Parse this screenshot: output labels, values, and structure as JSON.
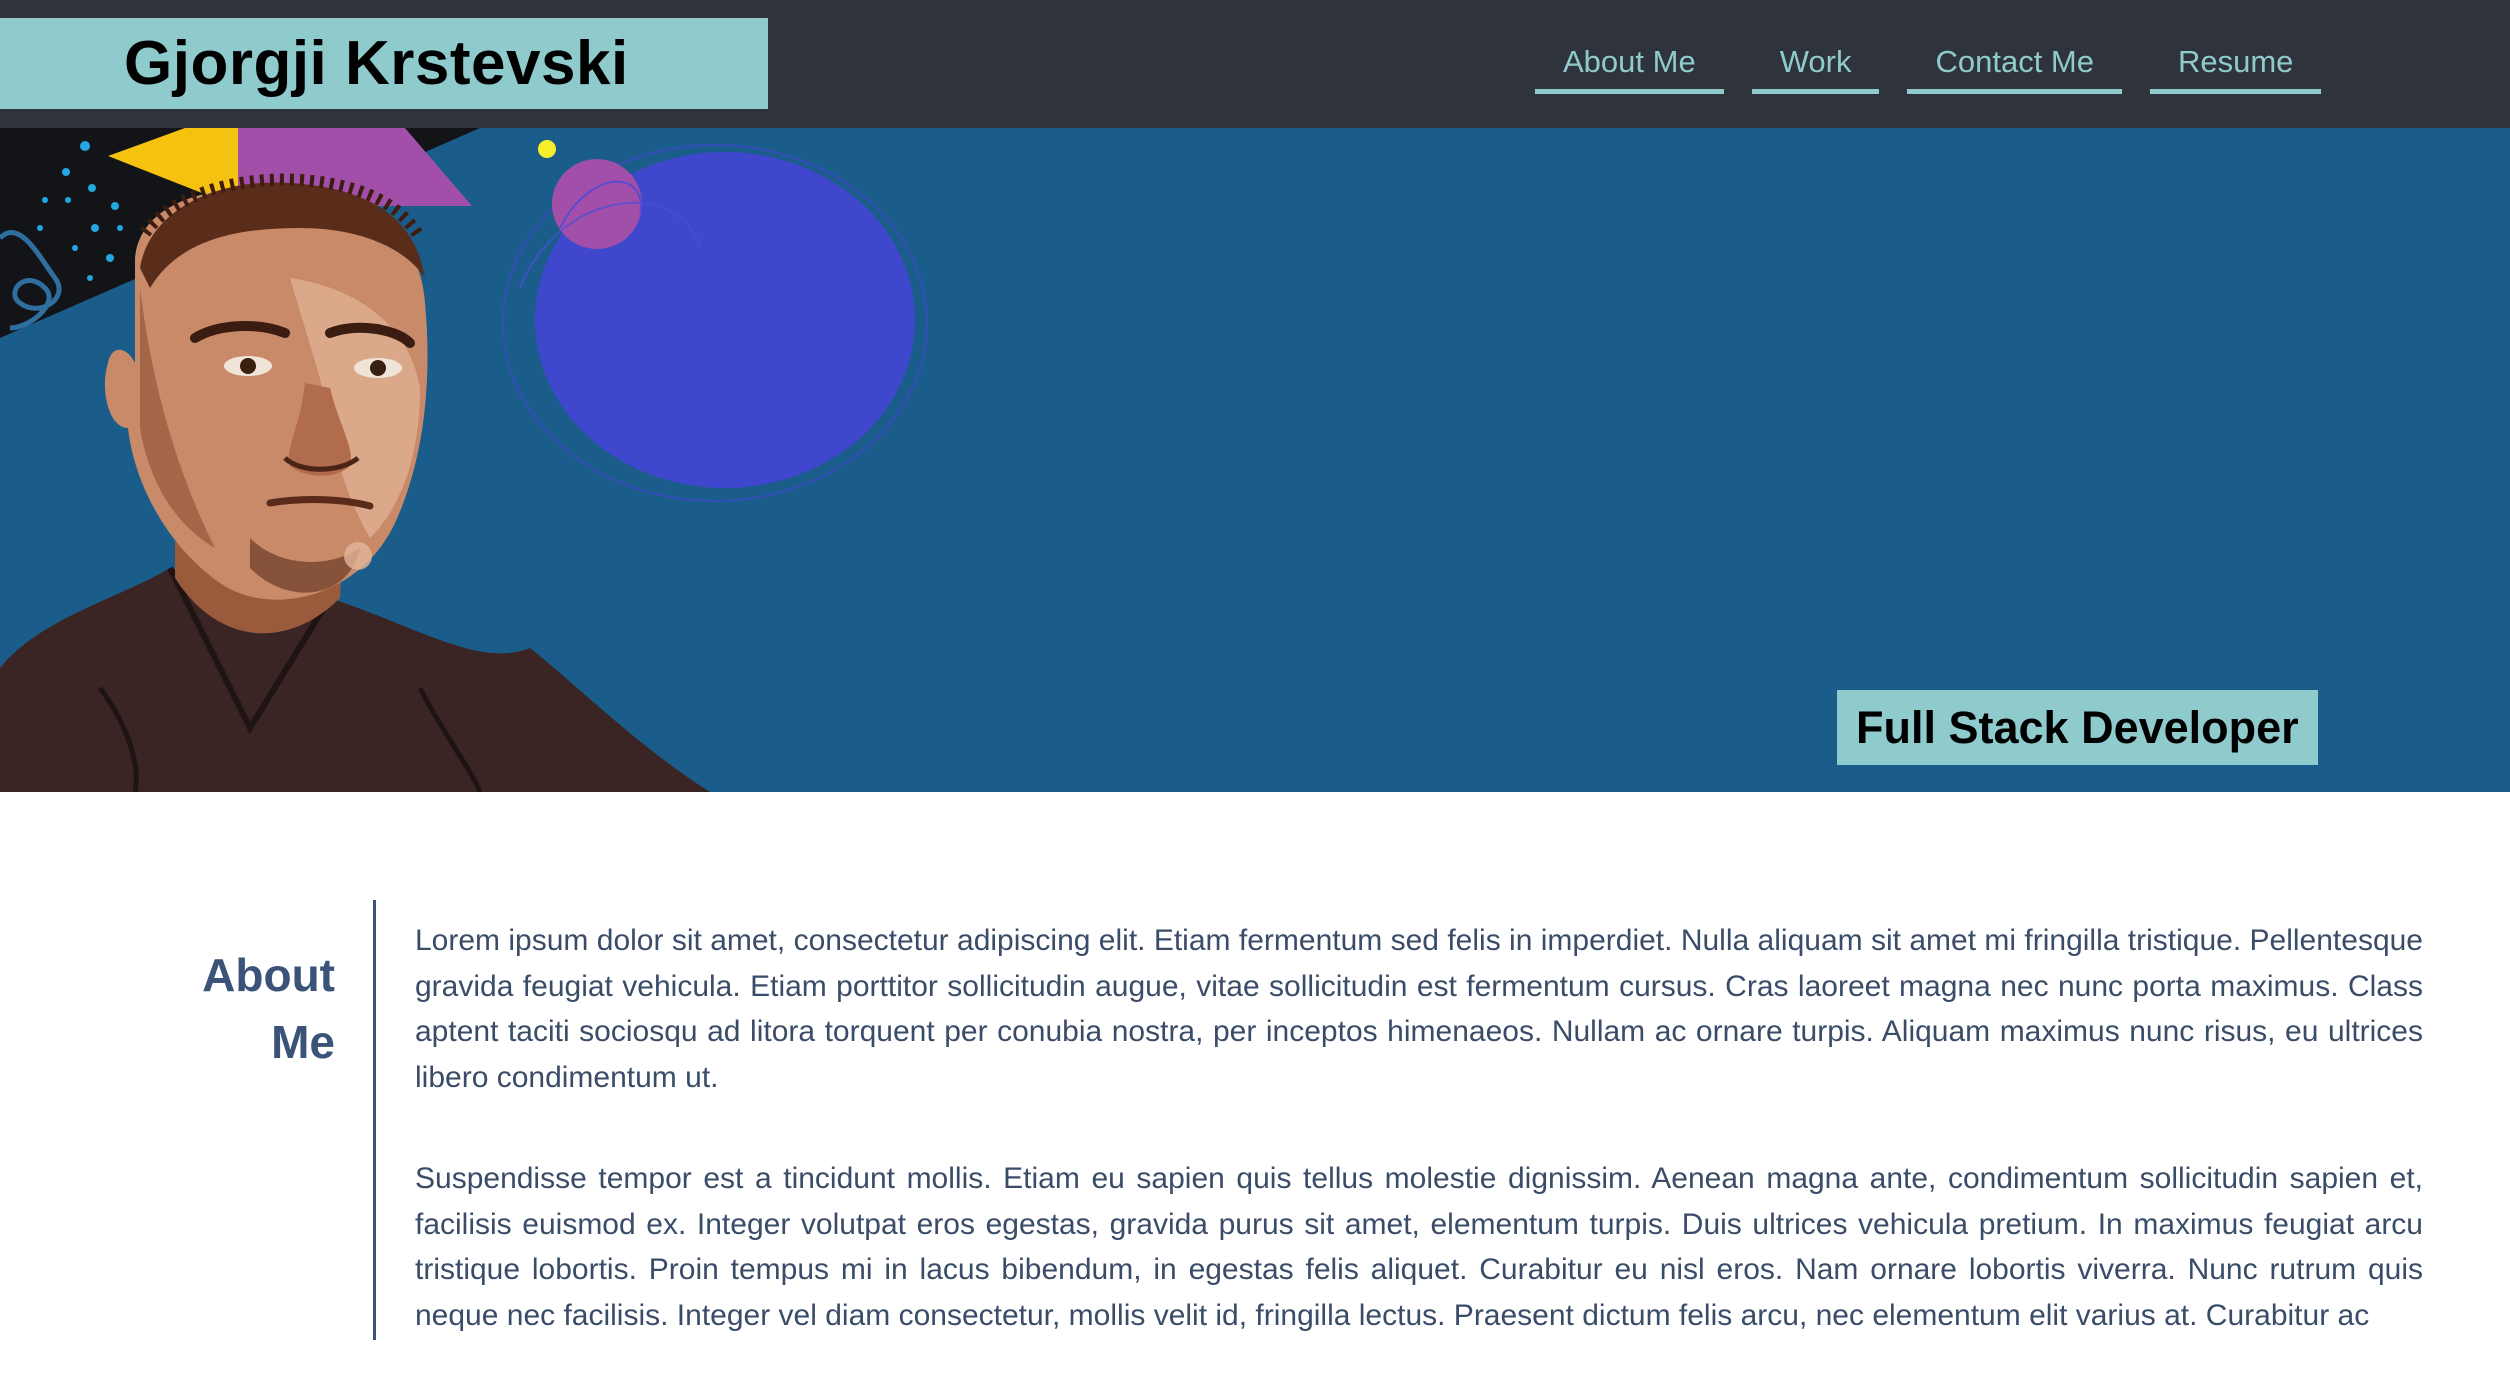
{
  "header": {
    "name": "Gjorgji Krstevski",
    "nav": [
      {
        "label": "About Me"
      },
      {
        "label": "Work"
      },
      {
        "label": "Contact Me"
      },
      {
        "label": "Resume"
      }
    ]
  },
  "hero": {
    "tagline": "Full Stack Developer",
    "image_icon": "portrait-illustration-icon"
  },
  "about": {
    "heading_line1": "About",
    "heading_line2": "Me",
    "paragraphs": [
      "Lorem ipsum dolor sit amet, consectetur adipiscing elit. Etiam fermentum sed felis in imperdiet. Nulla aliquam sit amet mi fringilla tristique. Pellentesque gravida feugiat vehicula. Etiam porttitor sollicitudin augue, vitae sollicitudin est fermentum cursus. Cras laoreet magna nec nunc porta maximus. Class aptent taciti sociosqu ad litora torquent per conubia nostra, per inceptos himenaeos. Nullam ac ornare turpis. Aliquam maximus nunc risus, eu ultrices libero condimentum ut.",
      "Suspendisse tempor est a tincidunt mollis. Etiam eu sapien quis tellus molestie dignissim. Aenean magna ante, condimentum sollicitudin sapien et, facilisis euismod ex. Integer volutpat eros egestas, gravida purus sit amet, elementum turpis. Duis ultrices vehicula pretium. In maximus feugiat arcu tristique lobortis. Proin tempus mi in lacus bibendum, in egestas felis aliquet. Curabitur eu nisl eros. Nam ornare lobortis viverra. Nunc rutrum quis neque nec facilisis. Integer vel diam consectetur, mollis velit id, fringilla lectus. Praesent dictum felis arcu, nec elementum elit varius at. Curabitur ac"
    ]
  },
  "colors": {
    "header_bg": "#2f333c",
    "accent": "#8fcbcc",
    "hero_bg": "#1b5d8a",
    "about_text": "#3a4c68",
    "about_heading": "#3b5378"
  }
}
